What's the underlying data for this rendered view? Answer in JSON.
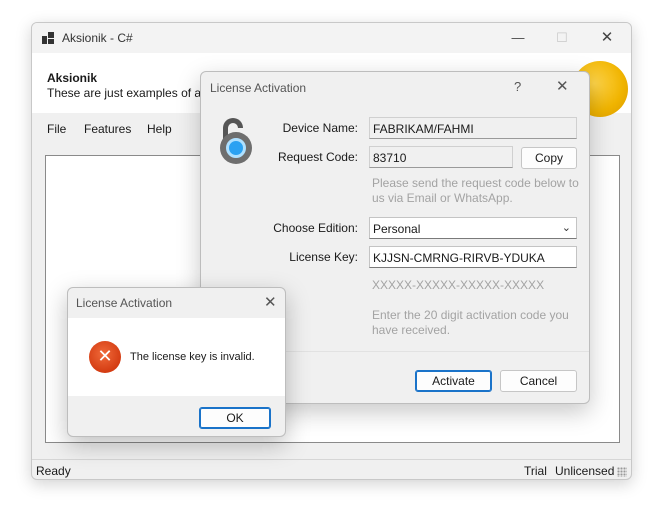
{
  "main_window": {
    "title": "Aksionik - C#",
    "header_title": "Aksionik",
    "header_subtitle": "These are just examples of ap",
    "menu": [
      "File",
      "Features",
      "Help"
    ],
    "status_left": "Ready",
    "status_trial": "Trial",
    "status_license": "Unlicensed",
    "minimize_glyph": "—",
    "maximize_glyph": "☐",
    "close_glyph": "✕"
  },
  "license_dialog": {
    "title": "License Activation",
    "help_glyph": "?",
    "close_glyph": "✕",
    "device_name_label": "Device Name:",
    "device_name_value": "FABRIKAM/FAHMI",
    "request_code_label": "Request Code:",
    "request_code_value": "83710",
    "copy_button": "Copy",
    "request_hint_line1": "Please send the request code below to",
    "request_hint_line2": "us via Email or WhatsApp.",
    "edition_label": "Choose Edition:",
    "edition_value": "Personal",
    "license_key_label": "License Key:",
    "license_key_value": "KJJSN-CMRNG-RIRVB-YDUKA",
    "key_format_hint": "XXXXX-XXXXX-XXXXX-XXXXX",
    "key_hint_line1": "Enter the 20 digit activation code you",
    "key_hint_line2": "have received.",
    "activate_button": "Activate",
    "cancel_button": "Cancel"
  },
  "error_box": {
    "title": "License Activation",
    "close_glyph": "✕",
    "icon_glyph": "✕",
    "message": "The license key is invalid.",
    "ok_button": "OK"
  },
  "colors": {
    "accent": "#1a73c9",
    "error": "#d43c12",
    "lock_core": "#2aa1f2",
    "coin": "#f0b400"
  }
}
